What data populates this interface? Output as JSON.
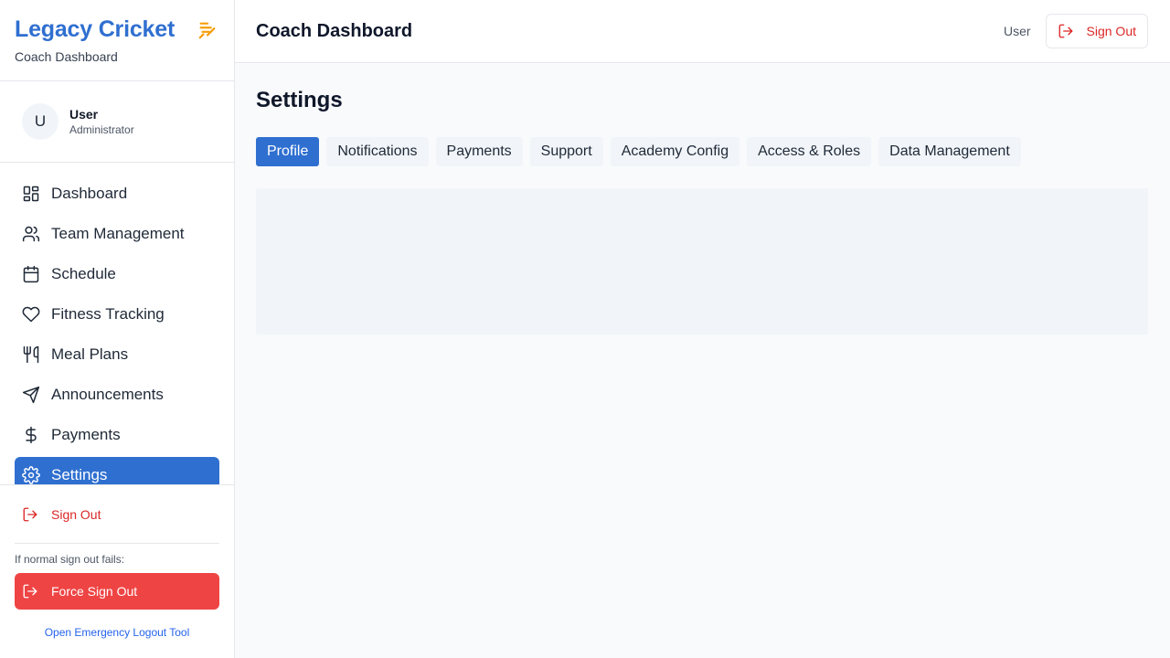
{
  "sidebar": {
    "brand_title": "Legacy Cricket",
    "brand_subtitle": "Coach Dashboard",
    "brand_icon": "cricket-icon",
    "user": {
      "initial": "U",
      "name": "User",
      "role": "Administrator"
    },
    "items": [
      {
        "label": "Dashboard",
        "icon": "dashboard-icon",
        "active": false
      },
      {
        "label": "Team Management",
        "icon": "users-icon",
        "active": false
      },
      {
        "label": "Schedule",
        "icon": "calendar-icon",
        "active": false
      },
      {
        "label": "Fitness Tracking",
        "icon": "heart-icon",
        "active": false
      },
      {
        "label": "Meal Plans",
        "icon": "utensils-icon",
        "active": false
      },
      {
        "label": "Announcements",
        "icon": "send-icon",
        "active": false
      },
      {
        "label": "Payments",
        "icon": "dollar-icon",
        "active": false
      },
      {
        "label": "Settings",
        "icon": "gear-icon",
        "active": true
      }
    ],
    "sign_out_label": "Sign Out",
    "fallback_note": "If normal sign out fails:",
    "force_sign_out_label": "Force Sign Out",
    "emergency_link": "Open Emergency Logout Tool"
  },
  "header": {
    "title": "Coach Dashboard",
    "user_label": "User",
    "sign_out_label": "Sign Out"
  },
  "main": {
    "title": "Settings",
    "tabs": [
      {
        "label": "Profile",
        "active": true
      },
      {
        "label": "Notifications",
        "active": false
      },
      {
        "label": "Payments",
        "active": false
      },
      {
        "label": "Support",
        "active": false
      },
      {
        "label": "Academy Config",
        "active": false
      },
      {
        "label": "Access & Roles",
        "active": false
      },
      {
        "label": "Data Management",
        "active": false
      }
    ]
  },
  "colors": {
    "accent": "#2f6fd0",
    "danger": "#ef4444",
    "danger_text": "#dc2626",
    "brand_icon": "#f59e0b"
  }
}
